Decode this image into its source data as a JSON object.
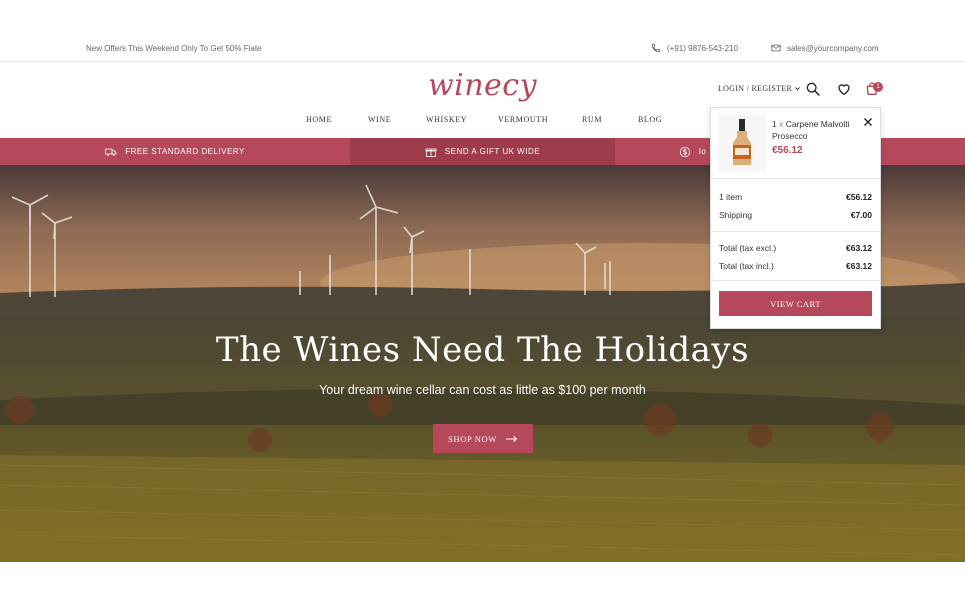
{
  "topbar": {
    "offer": "New Offers This Weekend Only To Get 50% Flate",
    "phone": "(+91) 9876-543-210",
    "email": "sales@yourcompany.com"
  },
  "header": {
    "logo": "winecy",
    "account": "LOGIN / REGISTER",
    "cart_count": "1"
  },
  "nav": {
    "items": [
      {
        "label": "HOME"
      },
      {
        "label": "WINE"
      },
      {
        "label": "WHISKEY"
      },
      {
        "label": "VERMOUTH"
      },
      {
        "label": "RUM"
      },
      {
        "label": "BLOG"
      }
    ]
  },
  "benefits": [
    {
      "label": "FREE STANDARD DELIVERY",
      "icon": "truck-icon"
    },
    {
      "label": "SEND A GIFT UK WIDE",
      "icon": "gift-icon"
    },
    {
      "label": "lo",
      "icon": "dollar-icon"
    }
  ],
  "hero": {
    "title": "The Wines Need The Holidays",
    "subtitle": "Your dream wine cellar can cost as little as $100 per month",
    "cta": "SHOP NOW"
  },
  "cart": {
    "qty_prefix": "1",
    "qty_sep": "x",
    "product": "Carpene Malvolti Prosecco",
    "price": "€56.12",
    "summary": [
      {
        "label": "1 item",
        "value": "€56.12"
      },
      {
        "label": "Shipping",
        "value": "€7.00"
      }
    ],
    "totals": [
      {
        "label": "Total (tax excl.)",
        "value": "€63.12"
      },
      {
        "label": "Total (tax incl.)",
        "value": "€63.12"
      }
    ],
    "button": "VIEW CART"
  },
  "colors": {
    "accent": "#b5495b",
    "accent_dark": "#9e3b4c"
  }
}
